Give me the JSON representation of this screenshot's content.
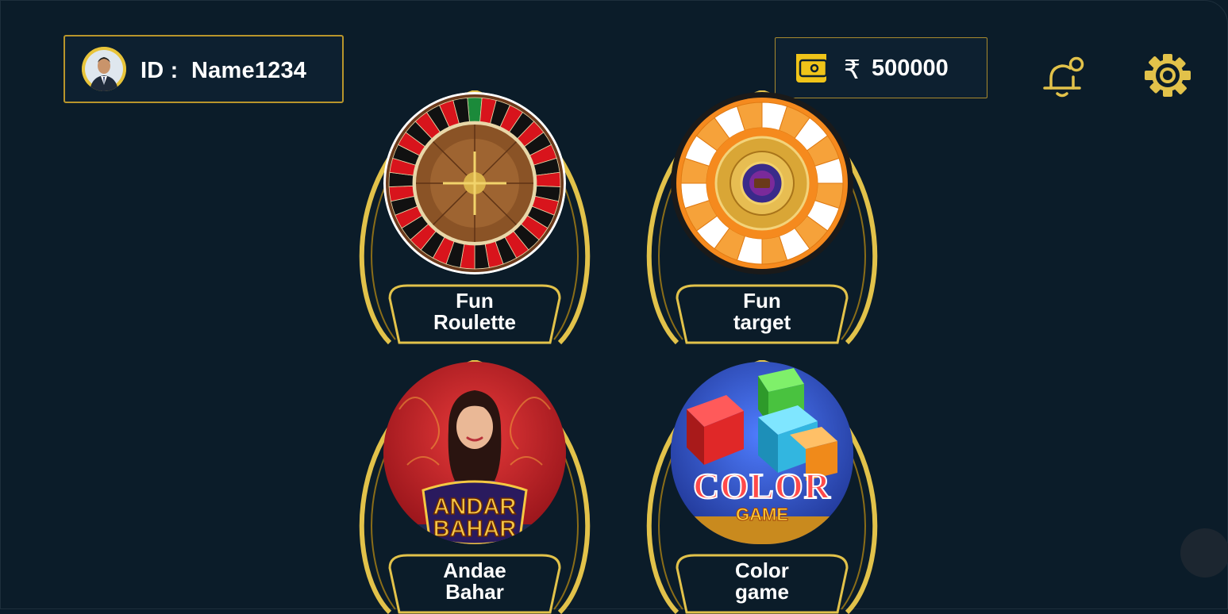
{
  "profile": {
    "id_prefix": "ID :",
    "username": "Name1234",
    "avatar_icon": "user-avatar"
  },
  "wallet": {
    "currency_symbol": "₹",
    "balance": "500000",
    "icon": "wallet-icon"
  },
  "header_icons": {
    "notification": "bell-icon",
    "settings": "gear-icon"
  },
  "games": [
    {
      "line1": "Fun",
      "line2": "Roulette",
      "thumb": "roulette-wheel"
    },
    {
      "line1": "Fun",
      "line2": "target",
      "thumb": "target-wheel"
    },
    {
      "line1": "Andae",
      "line2": "Bahar",
      "thumb": "andar-bahar-art",
      "art_line1": "ANDAR",
      "art_line2": "BAHAR"
    },
    {
      "line1": "Color",
      "line2": "game",
      "thumb": "color-game-art",
      "art_line1": "COLOR",
      "art_line2": "GAME"
    }
  ],
  "colors": {
    "background": "#0b1c29",
    "gold": "#e2c24a",
    "panel": "#0d2030"
  }
}
